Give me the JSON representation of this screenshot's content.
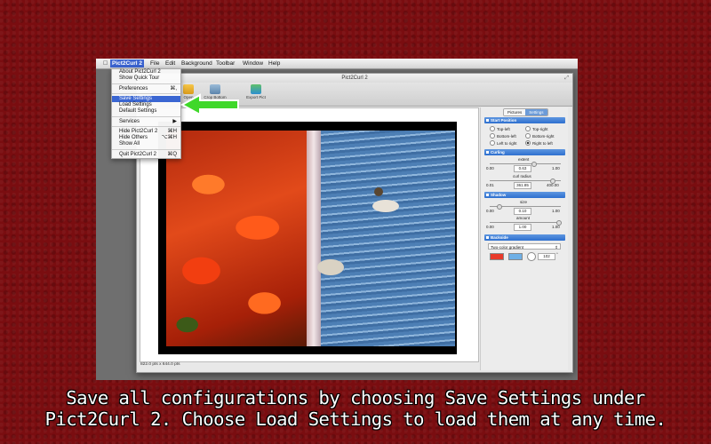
{
  "menubar": {
    "items": [
      "Pict2Curl 2",
      "File",
      "Edit",
      "Background",
      "Toolbar",
      "Window",
      "Help"
    ]
  },
  "window": {
    "title": "Pict2Curl 2"
  },
  "toolbar": {
    "items": [
      "Open",
      "Crop Bottom",
      "Export Pict"
    ]
  },
  "app_menu": {
    "items": [
      {
        "label": "About Pict2Curl 2",
        "shortcut": ""
      },
      {
        "label": "Show Quick Tour",
        "shortcut": ""
      },
      {
        "label": "Preferences",
        "shortcut": "⌘,"
      },
      {
        "label": "Save Settings",
        "shortcut": ""
      },
      {
        "label": "Load Settings",
        "shortcut": ""
      },
      {
        "label": "Default Settings",
        "shortcut": ""
      },
      {
        "label": "Services",
        "shortcut": "▶"
      },
      {
        "label": "Hide Pict2Curl 2",
        "shortcut": "⌘H"
      },
      {
        "label": "Hide Others",
        "shortcut": "⌥⌘H"
      },
      {
        "label": "Show All",
        "shortcut": ""
      },
      {
        "label": "Quit Pict2Curl 2",
        "shortcut": "⌘Q"
      }
    ]
  },
  "status": {
    "size_text": "822.0 pts x 644.0 pts"
  },
  "panel": {
    "tabs": [
      "Pictures",
      "Settings"
    ],
    "start_position": {
      "title": "Start Position",
      "options": [
        "Top-left",
        "Top-right",
        "Bottom-left",
        "Bottom-right",
        "Left to right",
        "Right to left"
      ],
      "selected": "Right to left"
    },
    "curling": {
      "title": "Curling",
      "extent_label": "extent",
      "extent_min": "0.00",
      "extent_value": "0.63",
      "extent_max": "1.00",
      "extent_level": 0.63,
      "radius_label": "curl radius",
      "radius_min": "0.01",
      "radius_value": "361.85",
      "radius_max": "400.00",
      "radius_level": 0.9
    },
    "shadow": {
      "title": "Shadow",
      "size_label": "size",
      "size_min": "0.00",
      "size_value": "0.10",
      "size_max": "1.00",
      "size_level": 0.1,
      "amount_label": "amount",
      "amount_min": "0.00",
      "amount_value": "1.00",
      "amount_max": "1.00",
      "amount_level": 1.0
    },
    "backside": {
      "title": "Backside",
      "mode": "Two-color gradient",
      "color1": "#e83a2a",
      "color2": "#6fb0e6",
      "angle": "102"
    }
  },
  "caption": {
    "line1": "Save all configurations by choosing Save Settings under",
    "line2": "Pict2Curl 2.  Choose Load Settings to load them at any time."
  },
  "colors": {
    "accent": "#3a66d2",
    "arrow": "#3fd82a",
    "background": "#7a0d10"
  }
}
